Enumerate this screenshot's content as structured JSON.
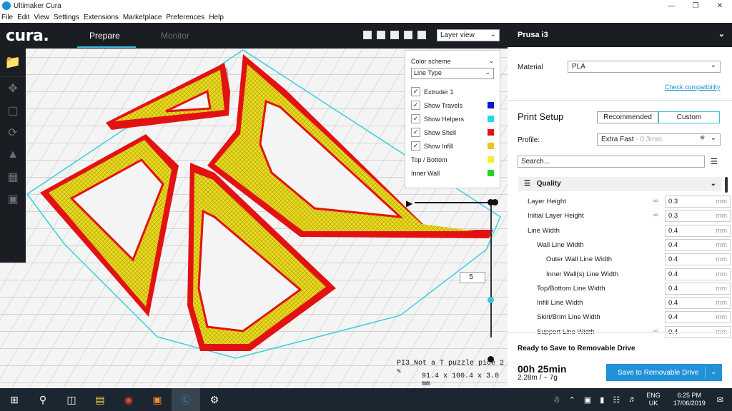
{
  "window": {
    "title": "Ultimaker Cura",
    "controls": [
      "minimize-icon",
      "maximize-icon",
      "close-icon"
    ]
  },
  "menu": [
    "File",
    "Edit",
    "View",
    "Settings",
    "Extensions",
    "Marketplace",
    "Preferences",
    "Help"
  ],
  "header": {
    "logo": "cura.",
    "tabs": [
      "Prepare",
      "Monitor"
    ],
    "active_tab": "Prepare",
    "view_select": "Layer view"
  },
  "legend": {
    "color_scheme_label": "Color scheme",
    "scheme_value": "Line Type",
    "items": [
      {
        "label": "Extruder 1",
        "checked": true,
        "color": ""
      },
      {
        "label": "Show Travels",
        "checked": true,
        "color": "#0a1ad4"
      },
      {
        "label": "Show Helpers",
        "checked": true,
        "color": "#21d9ea"
      },
      {
        "label": "Show Shell",
        "checked": true,
        "color": "#e31212"
      },
      {
        "label": "Show Infill",
        "checked": true,
        "color": "#e8c61a"
      },
      {
        "label": "Top / Bottom",
        "checked": false,
        "color": "#f2ef3a"
      },
      {
        "label": "Inner Wall",
        "checked": false,
        "color": "#26d626"
      }
    ]
  },
  "layer": {
    "current": "5"
  },
  "model": {
    "name": "PI3_Not a T puzzle pice 2",
    "dimensions": "91.4 x 100.4 x 3.0 mm"
  },
  "printer": {
    "name": "Prusa i3"
  },
  "material": {
    "label": "Material",
    "value": "PLA",
    "compat_link": "Check compatibility"
  },
  "print_setup": {
    "title": "Print Setup",
    "mode_buttons": [
      "Recommended",
      "Custom"
    ],
    "active_mode": "Custom",
    "profile_label": "Profile:",
    "profile_value": "Extra Fast",
    "profile_sub": "- 0.3mm",
    "search_placeholder": "Search...",
    "section": "Quality"
  },
  "settings": [
    {
      "name": "Layer Height",
      "value": "0.3",
      "unit": "mm",
      "indent": 0,
      "linked": true
    },
    {
      "name": "Initial Layer Height",
      "value": "0.3",
      "unit": "mm",
      "indent": 0,
      "linked": true
    },
    {
      "name": "Line Width",
      "value": "0.4",
      "unit": "mm",
      "indent": 0,
      "linked": false
    },
    {
      "name": "Wall Line Width",
      "value": "0.4",
      "unit": "mm",
      "indent": 1,
      "linked": false
    },
    {
      "name": "Outer Wall Line Width",
      "value": "0.4",
      "unit": "mm",
      "indent": 2,
      "linked": false
    },
    {
      "name": "Inner Wall(s) Line Width",
      "value": "0.4",
      "unit": "mm",
      "indent": 2,
      "linked": false
    },
    {
      "name": "Top/Bottom Line Width",
      "value": "0.4",
      "unit": "mm",
      "indent": 1,
      "linked": false
    },
    {
      "name": "Infill Line Width",
      "value": "0.4",
      "unit": "mm",
      "indent": 1,
      "linked": false
    },
    {
      "name": "Skirt/Brim Line Width",
      "value": "0.4",
      "unit": "mm",
      "indent": 1,
      "linked": false
    },
    {
      "name": "Support Line Width",
      "value": "0.4",
      "unit": "mm",
      "indent": 1,
      "linked": true
    }
  ],
  "output": {
    "status": "Ready to Save to Removable Drive",
    "time": "00h 25min",
    "material_usage": "2.28m / ~ 7g",
    "save_button": "Save to Removable Drive"
  },
  "taskbar": {
    "lang_1": "ENG",
    "lang_2": "UK",
    "time": "6:25 PM",
    "date": "17/06/2019"
  }
}
